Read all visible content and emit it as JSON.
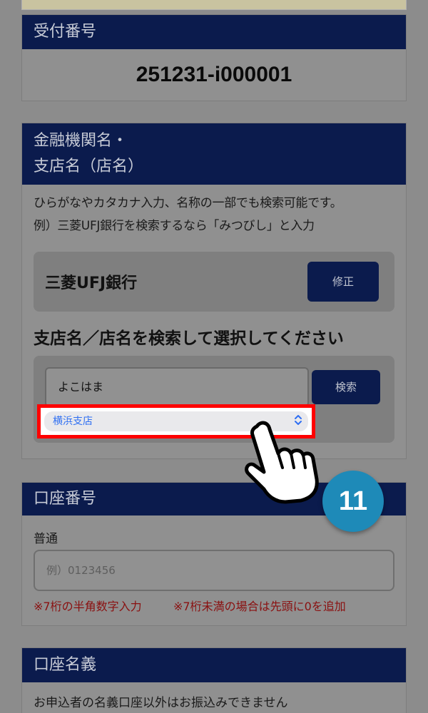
{
  "receipt": {
    "heading": "受付番号",
    "number": "251231-i000001"
  },
  "bank": {
    "heading_line1": "金融機関名・",
    "heading_line2": "支店名（店名）",
    "hint_line1": "ひらがなやカタカナ入力、名称の一部でも検索可能です。",
    "hint_line2": "例）三菱UFJ銀行を検索するなら「みつびし」と入力",
    "selected_bank": "三菱UFJ銀行",
    "edit_label": "修正",
    "branch_title": "支店名／店名を検索して選択してください",
    "search_value": "よこはま",
    "search_label": "検索",
    "branch_select_value": "横浜支店"
  },
  "account": {
    "heading": "口座番号",
    "type_label": "普通",
    "number_placeholder": "例）0123456",
    "note_digits": "※7桁の半角数字入力",
    "note_pad": "※7桁未満の場合は先頭に0を追加"
  },
  "holder": {
    "heading": "口座名義",
    "hint": "お申込者の名義口座以外はお振込みできません"
  },
  "overlay": {
    "step_number": "11",
    "highlight_color": "#ff0000",
    "badge_color": "#1e8ab8"
  },
  "colors": {
    "header_navy": "#0b1b4d",
    "accent_blue": "#2f6ff2",
    "note_red": "#8a1010"
  }
}
